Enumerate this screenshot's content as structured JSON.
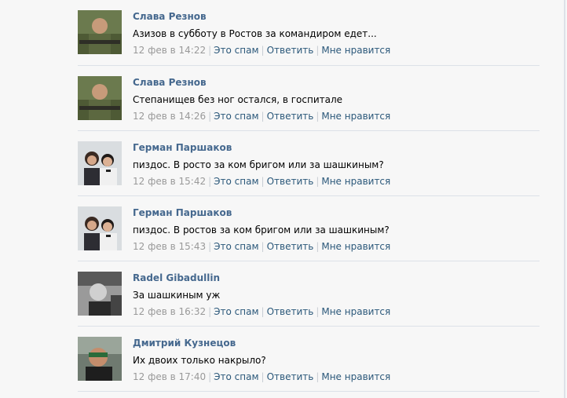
{
  "comments": [
    {
      "author": "Слава Резнов",
      "text": "Азизов в субботу в Ростов за командиром едет...",
      "date": "12 фев в 14:22",
      "avatar_icon": "avatar-soldier-photo",
      "actions": {
        "spam": "Это спам",
        "reply": "Ответить",
        "like": "Мне нравится"
      }
    },
    {
      "author": "Слава Резнов",
      "text": "Степанищев без ног остался, в госпитале",
      "date": "12 фев в 14:26",
      "avatar_icon": "avatar-soldier-photo",
      "actions": {
        "spam": "Это спам",
        "reply": "Ответить",
        "like": "Мне нравится"
      }
    },
    {
      "author": "Герман Паршаков",
      "text": "пиздос. В росто за ком бригом или за шашкиным?",
      "date": "12 фев в 15:42",
      "avatar_icon": "avatar-couple-photo",
      "actions": {
        "spam": "Это спам",
        "reply": "Ответить",
        "like": "Мне нравится"
      }
    },
    {
      "author": "Герман Паршаков",
      "text": "пиздос. В ростов за ком бригом или за шашкиным?",
      "date": "12 фев в 15:43",
      "avatar_icon": "avatar-couple-photo",
      "actions": {
        "spam": "Это спам",
        "reply": "Ответить",
        "like": "Мне нравится"
      }
    },
    {
      "author": "Radel Gibadullin",
      "text": "За шашкиным уж",
      "date": "12 фев в 16:32",
      "avatar_icon": "avatar-bw-photo",
      "actions": {
        "spam": "Это спам",
        "reply": "Ответить",
        "like": "Мне нравится"
      }
    },
    {
      "author": "Дмитрий Кузнецов",
      "text": "Их двоих только накрыло?",
      "date": "12 фев в 17:40",
      "avatar_icon": "avatar-sunglasses-photo",
      "actions": {
        "spam": "Это спам",
        "reply": "Ответить",
        "like": "Мне нравится"
      }
    }
  ],
  "colors": {
    "author": "#45688e",
    "link": "#2b587a",
    "date": "#999999",
    "background": "#f7f7f7",
    "divider": "#dce1e8"
  }
}
